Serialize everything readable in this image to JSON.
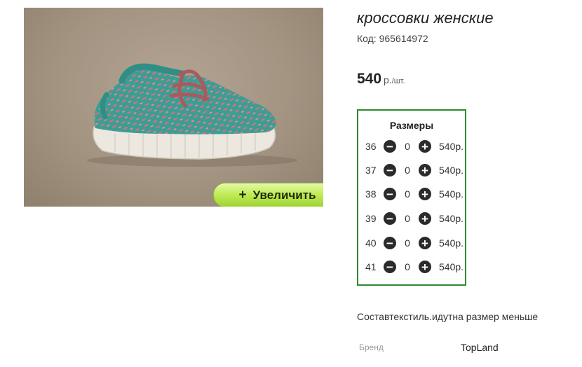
{
  "product": {
    "title": "кроссовки женские",
    "code": "Код: 965614972",
    "price_amount": "540",
    "price_unit": "р.",
    "price_per": "/шт.",
    "description": "Составтекстиль.идутна размер меньше",
    "brand_label": "Бренд",
    "brand_value": "TopLand"
  },
  "gallery": {
    "zoom_icon": "+",
    "zoom_label": "Увеличить"
  },
  "sizes": {
    "title": "Размеры",
    "minus_icon": "minus-icon",
    "plus_icon": "plus-icon",
    "rows": [
      {
        "size": "36",
        "qty": "0",
        "price": "540р."
      },
      {
        "size": "37",
        "qty": "0",
        "price": "540р."
      },
      {
        "size": "38",
        "qty": "0",
        "price": "540р."
      },
      {
        "size": "39",
        "qty": "0",
        "price": "540р."
      },
      {
        "size": "40",
        "qty": "0",
        "price": "540р."
      },
      {
        "size": "41",
        "qty": "0",
        "price": "540р."
      }
    ]
  },
  "colors": {
    "sizes_border": "#2e8b2e",
    "zoom_button": "#a6d93a",
    "photo_background": "#a39482",
    "shoe_knit": "#3a9e94",
    "shoe_pattern": "#d5707c",
    "shoe_sole": "#ece8e0"
  }
}
